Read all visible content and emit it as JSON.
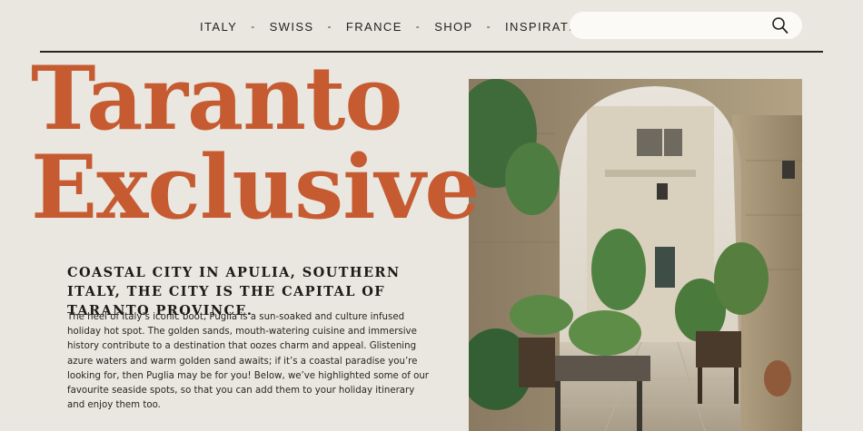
{
  "nav": {
    "items": [
      "ITALY",
      "SWISS",
      "FRANCE",
      "SHOP",
      "INSPIRATION"
    ],
    "separator": "-"
  },
  "search": {
    "placeholder": "",
    "value": "",
    "icon": "search-icon"
  },
  "hero": {
    "title_line1": "Taranto",
    "title_line2": "Exclusive",
    "title_color": "#c65b32",
    "subtitle": "COASTAL CITY IN APULIA, SOUTHERN ITALY, THE CITY IS THE CAPITAL OF TARANTO PROVINCE.",
    "body": "The heel of Italy’s iconic boot, Puglia is a sun-soaked and culture infused holiday hot spot. The golden sands, mouth-watering cuisine and immersive history contribute to a destination that oozes charm and appeal. Glistening azure waters and warm golden sand awaits; if it’s a coastal paradise you’re looking for, then Puglia may be for you! Below, we’ve highlighted some of our favourite seaside spots, so that you can add them to your holiday itinerary and enjoy them too."
  },
  "colors": {
    "background": "#e9e7df",
    "accent": "#c65b32",
    "text": "#1e1a17"
  }
}
